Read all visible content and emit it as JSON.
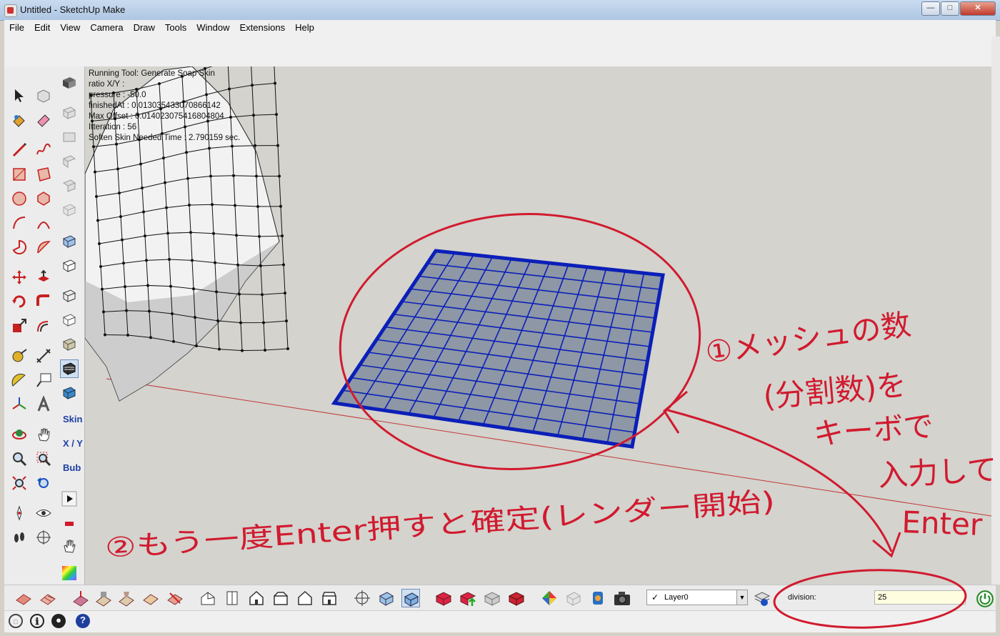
{
  "window": {
    "title": "Untitled - SketchUp Make",
    "minimize": "—",
    "maximize": "□",
    "close": "✕"
  },
  "menu": [
    "File",
    "Edit",
    "View",
    "Camera",
    "Draw",
    "Tools",
    "Window",
    "Extensions",
    "Help"
  ],
  "viewport_info": [
    "Running Tool: Generate Soap Skin",
    "ratio X/Y :",
    "pressure  : -50.0",
    "finishedAt  : 0.013035433070866142",
    "Max Offset : 0.014023075416804804",
    "Itteration : 56",
    "Soften Skin Needed Time : 2.790159 sec."
  ],
  "soap_toolbar": {
    "skin": "Skin",
    "xy": "X / Y",
    "bub": "Bub"
  },
  "layer": {
    "name": "Layer0",
    "check": "✓",
    "arrow": "▼"
  },
  "vcb": {
    "label": "division:",
    "value": "25"
  },
  "status_icons": [
    "geolocation-icon",
    "credits-icon",
    "user-icon",
    "help-icon"
  ],
  "annotations": {
    "step1_lines": [
      "①メッシュの数",
      "(分割数)を",
      "キーボで",
      "入力して",
      "Enter"
    ],
    "step2": "②もう一度Enter押すと確定(レンダー開始)"
  },
  "colors": {
    "annotation": "#d11a2e",
    "mesh": "#0b1fb8",
    "axis_red": "#c23a3a"
  }
}
